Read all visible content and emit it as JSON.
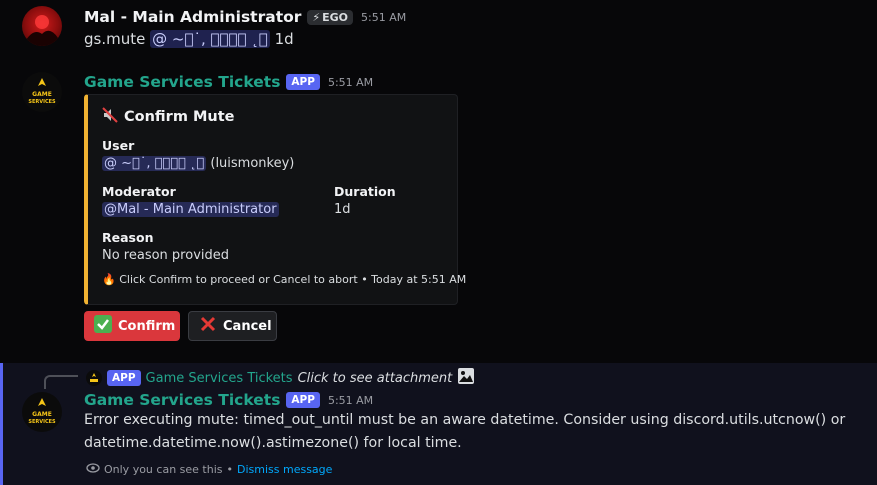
{
  "msg1": {
    "username": "Mal - Main Administrator",
    "tag": "EGO",
    "tag_icon": "lightning-icon",
    "timestamp": "5:51 AM",
    "text_prefix": "gs.mute",
    "mention": "@ ~\u0000˙, 𝓕𝓲𝓼𝓱 ˛\u0000",
    "text_suffix": "1d"
  },
  "msg2": {
    "username": "Game Services Tickets",
    "badge": "APP",
    "timestamp": "5:51 AM",
    "embed": {
      "accent_color": "#f0b232",
      "title_icon": "muted-speaker-icon",
      "title": "Confirm Mute",
      "user_label": "User",
      "user_mention": "@ ~\u0000˙, 𝓕𝓲𝓼𝓱 ˛\u0000",
      "user_handle": "(luismonkey)",
      "moderator_label": "Moderator",
      "moderator_value": "@Mal - Main Administrator",
      "duration_label": "Duration",
      "duration_value": "1d",
      "reason_label": "Reason",
      "reason_value": "No reason provided",
      "footer_icon": "fire-icon",
      "footer": "Click Confirm to proceed or Cancel to abort • Today at 5:51 AM"
    },
    "buttons": {
      "confirm_label": "Confirm",
      "cancel_label": "Cancel"
    }
  },
  "msg3": {
    "reply_badge": "APP",
    "reply_username": "Game Services Tickets",
    "reply_text": "Click to see attachment",
    "username": "Game Services Tickets",
    "badge": "APP",
    "timestamp": "5:51 AM",
    "line1": "Error executing mute: timed_out_until must be an aware datetime. Consider using discord.utils.utcnow() or",
    "line2": "datetime.datetime.now().astimezone() for local time.",
    "only_you": "Only you can see this",
    "separator": "•",
    "dismiss": "Dismiss message"
  },
  "colors": {
    "background": "#070709",
    "app_badge": "#5865f2",
    "bot_name": "#23a58c",
    "confirm_button": "#da373c"
  }
}
